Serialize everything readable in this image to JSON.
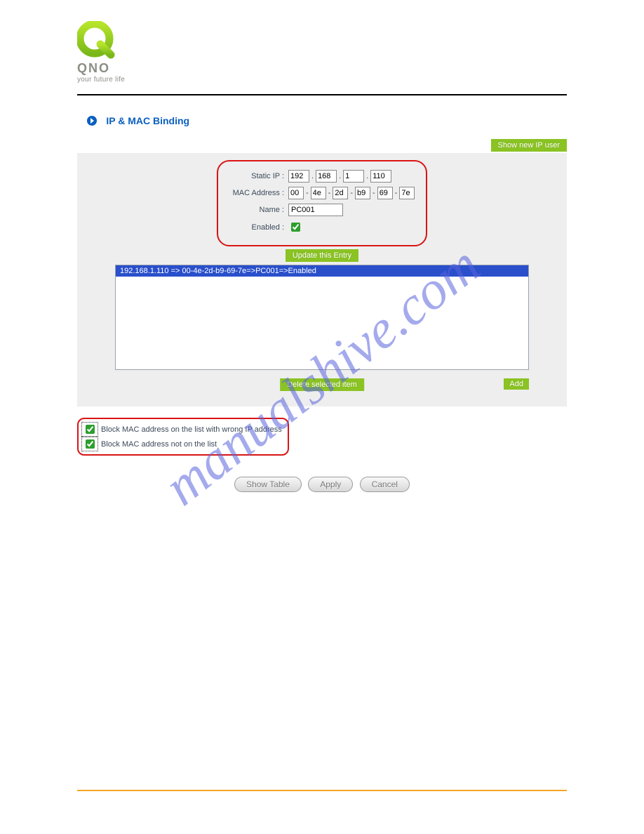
{
  "brand": {
    "name": "QNO",
    "tagline": "your future life"
  },
  "section": {
    "title": "IP & MAC Binding"
  },
  "buttons": {
    "show_new_ip_user": "Show new IP user",
    "update_this_entry": "Update this Entry",
    "delete_selected": "Delete selected item",
    "add": "Add",
    "show_table": "Show Table",
    "apply": "Apply",
    "cancel": "Cancel"
  },
  "form": {
    "static_ip_label": "Static IP :",
    "static_ip": [
      "192",
      "168",
      "1",
      "110"
    ],
    "ip_sep": ".",
    "mac_label": "MAC Address :",
    "mac": [
      "00",
      "4e",
      "2d",
      "b9",
      "69",
      "7e"
    ],
    "mac_sep": "-",
    "name_label": "Name :",
    "name_value": "PC001",
    "enabled_label": "Enabled :",
    "enabled_checked": true
  },
  "entries": {
    "selected": "192.168.1.110 => 00-4e-2d-b9-69-7e=>PC001=>Enabled"
  },
  "block_opts": {
    "wrong_ip_label": "Block MAC address on the list with wrong IP address",
    "wrong_ip_checked": true,
    "not_on_list_label": "Block MAC address not on the list",
    "not_on_list_checked": true
  },
  "watermark": "manualshive.com"
}
